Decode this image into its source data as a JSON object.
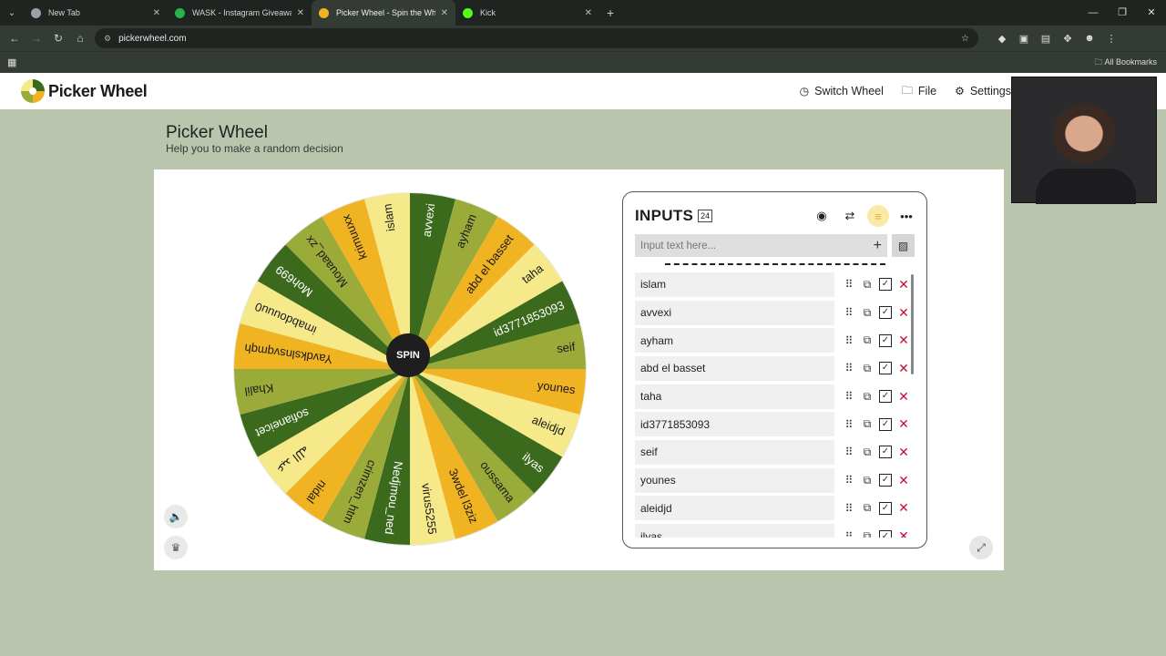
{
  "browser": {
    "tabs": [
      {
        "title": "New Tab",
        "active": false,
        "favicon_color": "#9aa0a6"
      },
      {
        "title": "WASK - Instagram Giveaway",
        "active": false,
        "favicon_color": "#27b34b"
      },
      {
        "title": "Picker Wheel - Spin the Wheel",
        "active": true,
        "favicon_color": "#f0b322"
      },
      {
        "title": "Kick",
        "active": false,
        "favicon_color": "#53fc18"
      }
    ],
    "url": "pickerwheel.com",
    "bookmarks_label": "All Bookmarks"
  },
  "header": {
    "logo_text": "Picker Wheel",
    "nav": [
      {
        "label": "Switch Wheel",
        "icon": "timer-icon"
      },
      {
        "label": "File",
        "icon": "folder-icon"
      },
      {
        "label": "Settings",
        "icon": "gear-icon"
      }
    ]
  },
  "page": {
    "title": "Picker Wheel",
    "subtitle": "Help you to make a random decision"
  },
  "wheel": {
    "spin_label": "SPIN",
    "colors": [
      "#3c6a1c",
      "#9bab3a",
      "#f0b322",
      "#f6e98a"
    ],
    "segments": [
      "avvexi",
      "ayham",
      "abd el basset",
      "taha",
      "id3771853093",
      "seif",
      "younes",
      "aleidjd",
      "ilyas",
      "oussama",
      "3wdel l3ziz",
      "virus5255",
      "Nedjmou_ned",
      "crimzen_htm",
      "nidal",
      "عبد الله",
      "sofianeicet",
      "Khalil",
      "Yavdkslnsvqmqh",
      "imabdouuu0",
      "Moh699",
      "Mouaad_zx",
      "krimuuxx",
      "islam"
    ]
  },
  "inputs": {
    "title": "INPUTS",
    "count": "24",
    "placeholder": "Input text here...",
    "items": [
      "islam",
      "avvexi",
      "ayham",
      "abd el basset",
      "taha",
      "id3771853093",
      "seif",
      "younes",
      "aleidjd",
      "ilyas"
    ]
  }
}
